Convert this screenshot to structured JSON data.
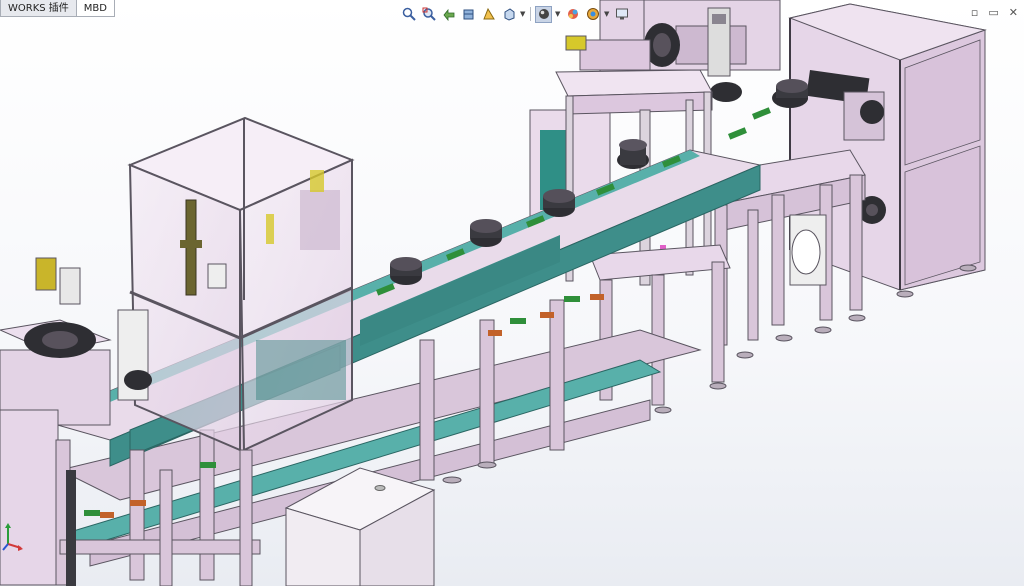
{
  "tabs": [
    {
      "label": "WORKS 插件",
      "active": false
    },
    {
      "label": "MBD",
      "active": true
    }
  ],
  "view_toolbar": {
    "icons": [
      "zoom-to-fit-icon",
      "zoom-to-area-icon",
      "previous-view-icon",
      "section-view-icon",
      "dynamic-annotation-icon",
      "view-orientation-icon",
      "display-style-icon",
      "hide-show-items-icon",
      "edit-appearance-icon",
      "apply-scene-icon",
      "view-settings-icon",
      "screen-monitor-icon"
    ]
  },
  "window_controls": {
    "restore": "▫",
    "minimize": "▭",
    "close": "✕"
  },
  "colors": {
    "frame": "#d9c6da",
    "frame_edge": "#5a5560",
    "teal": "#3e8e8a",
    "teal_light": "#58b0aa",
    "green": "#2f8f3a",
    "orange": "#c2622a",
    "dark": "#2e2e33",
    "yellow": "#d6c82a",
    "toolbar_bg": "#e7e9ee"
  }
}
